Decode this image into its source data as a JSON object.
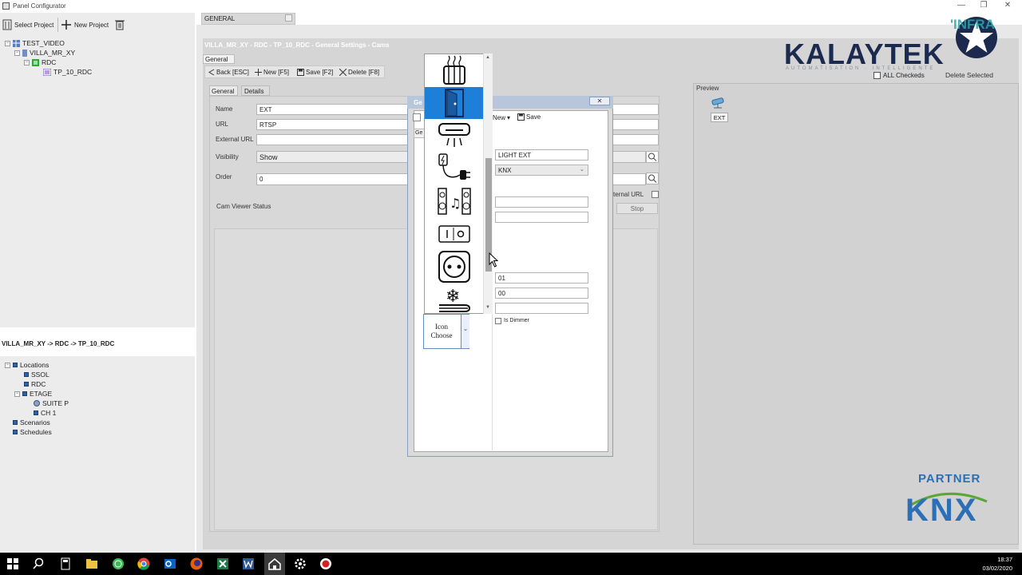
{
  "window": {
    "title": "Panel Configurator",
    "minimize": "—",
    "maximize": "❐",
    "close": "✕"
  },
  "toolbar": {
    "select_project": "Select Project",
    "new_project": "New Project"
  },
  "tree": {
    "root": "TEST_VIDEO",
    "villa": "VILLA_MR_XY",
    "rdc": "RDC",
    "panel": "TP_10_RDC"
  },
  "breadcrumb": "VILLA_MR_XY -> RDC -> TP_10_RDC",
  "locations": {
    "title": "Locations",
    "items": [
      "SSOL",
      "RDC",
      "ETAGE"
    ],
    "sub": [
      "SUITE P",
      "CH 1"
    ],
    "scenarios": "Scenarios",
    "schedules": "Schedules"
  },
  "doc_tab": {
    "label": "GENERAL"
  },
  "header": {
    "title": "VILLA_MR_XY - RDC - TP_10_RDC - General Settings - Cams"
  },
  "general_tab": "General",
  "actions": {
    "back": "Back [ESC]",
    "new": "New [F5]",
    "save": "Save [F2]",
    "delete": "Delete [F8]"
  },
  "subtabs": {
    "general": "General",
    "details": "Details"
  },
  "form": {
    "name_label": "Name",
    "name_value": "EXT",
    "url_label": "URL",
    "url_value": "RTSP",
    "external_url_label": "External URL",
    "external_url_value": "",
    "visibility_label": "Visibility",
    "visibility_value": "Show",
    "order_label": "Order",
    "order_value": "0",
    "cam_status_label": "Cam Viewer Status",
    "external_url_check_label": "ternal URL",
    "stop_label": "Stop"
  },
  "preview": {
    "title": "Preview",
    "cam_label": "EXT"
  },
  "brand": {
    "kalaytek": "KALAYTEK",
    "subtitle": "AUTOMATISATION · INTELLIGENTE",
    "partner": "PARTNER",
    "knx": "KNX",
    "infra": "'INFRA"
  },
  "bulk": {
    "all_checkeds": "ALL Checkeds",
    "delete_selected": "Delete Selected"
  },
  "dialog": {
    "title": "Ge",
    "tab": "Ge",
    "new": "New",
    "save": "Save",
    "name_value": "LIGHT EXT",
    "type_value": "KNX",
    "addr1": "01",
    "addr2": "00",
    "is_dimmer": "Is Dimmer",
    "icon_choose": "Icon Choose",
    "close": "✕"
  },
  "icons": [
    "radiator-icon",
    "door-icon",
    "air-conditioner-icon",
    "plug-icon",
    "speakers-music-icon",
    "switch-io-icon",
    "socket-icon",
    "snow-radiator-icon"
  ],
  "clock": {
    "time": "18:37",
    "date": "03/02/2020"
  },
  "colors": {
    "selection": "#1e7fd8",
    "brand_navy": "#1b2a4e",
    "knx_green": "#5aa832",
    "knx_blue": "#2c6fb6"
  }
}
